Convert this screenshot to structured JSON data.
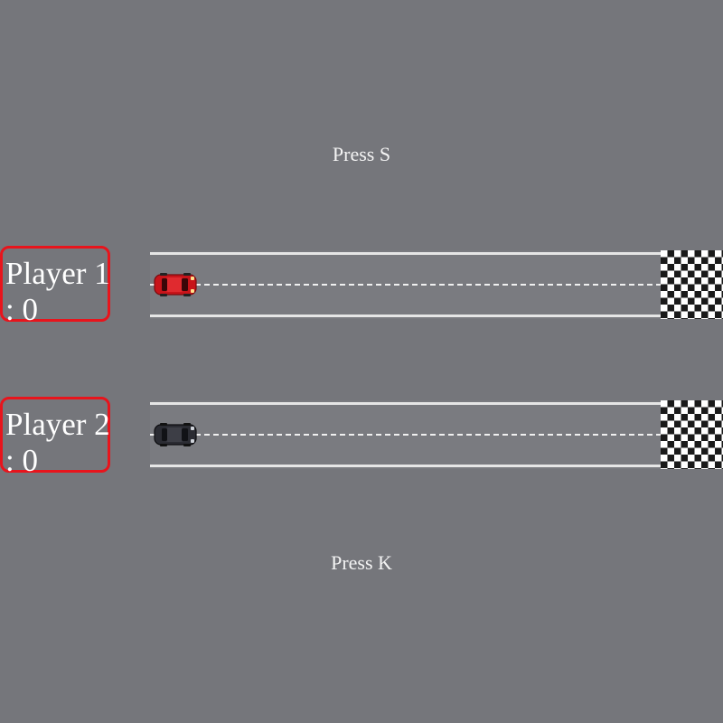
{
  "hints": {
    "player1_key": "Press S",
    "player2_key": "Press K"
  },
  "players": [
    {
      "label": "Player 1",
      "score": "0",
      "score_text": "Player 1 : 0",
      "car_color": "#d41a1a"
    },
    {
      "label": "Player 2",
      "score": "0",
      "score_text": "Player 2 : 0",
      "car_color": "#2b2c33"
    }
  ],
  "colors": {
    "background": "#75767b",
    "score_border": "#e8141c",
    "lane_markings": "#e6e6e6"
  },
  "icons": {
    "finish": "checkered-flag-icon",
    "car": "race-car-icon"
  }
}
